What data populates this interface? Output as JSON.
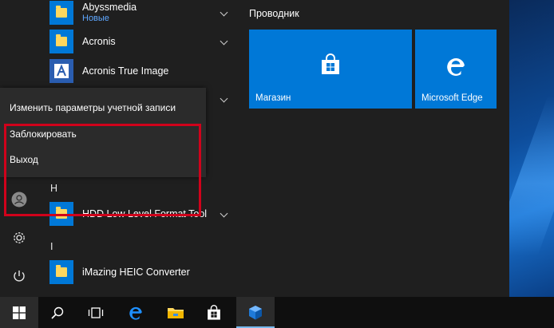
{
  "apps": [
    {
      "name": "Abyssmedia",
      "sub": "Новые",
      "icon": "folder-icon",
      "expand": true
    },
    {
      "name": "Acronis",
      "icon": "folder-icon",
      "expand": true
    },
    {
      "name": "Acronis True Image",
      "icon": "acronis-logo-icon",
      "expand": false
    }
  ],
  "letters": {
    "h": "H",
    "i": "I"
  },
  "apps_h": [
    {
      "name": "HDD Low Level Format Tool",
      "icon": "folder-icon",
      "expand": true
    }
  ],
  "apps_i": [
    {
      "name": "iMazing HEIC Converter",
      "icon": "folder-icon",
      "expand": false
    }
  ],
  "tiles": {
    "group_title": "Проводник",
    "items": [
      {
        "label": "Магазин",
        "icon": "store-bag-icon"
      },
      {
        "label": "Microsoft Edge",
        "icon": "edge-icon"
      }
    ]
  },
  "account_menu": {
    "change_settings": "Изменить параметры учетной записи",
    "lock": "Заблокировать",
    "sign_out": "Выход"
  },
  "colors": {
    "accent": "#0078d7",
    "highlight": "#d0021b",
    "folder": "#ffd75e"
  }
}
